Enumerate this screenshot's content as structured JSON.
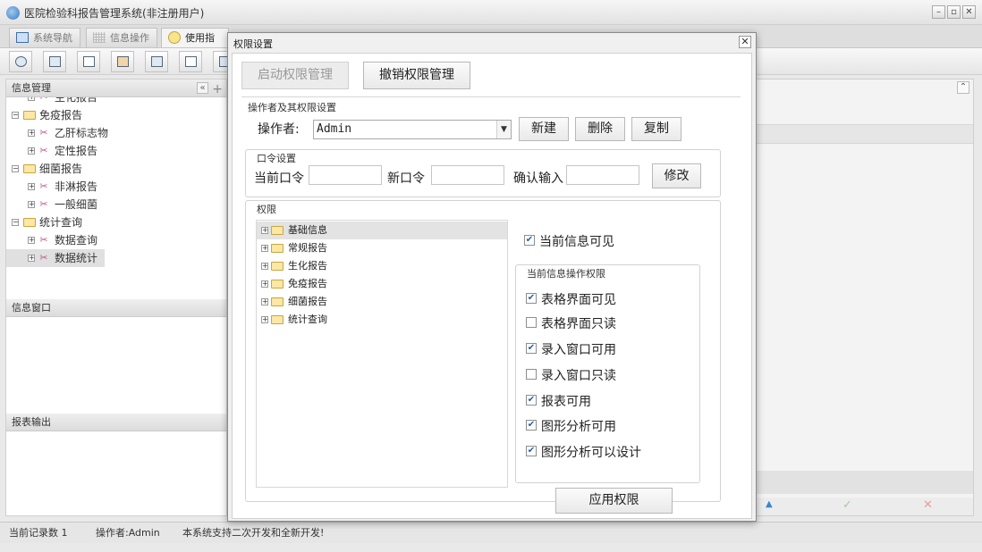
{
  "app": {
    "title": "医院检验科报告管理系统(非注册用户)"
  },
  "tabs": [
    {
      "label": "系统导航"
    },
    {
      "label": "信息操作"
    },
    {
      "label": "使用指南"
    }
  ],
  "left": {
    "info_header": "信息管理",
    "tree": [
      {
        "label": "生化报告",
        "kind": "leaf"
      },
      {
        "label": "免疫报告",
        "kind": "folder"
      },
      {
        "label": "乙肝标志物",
        "kind": "leaf"
      },
      {
        "label": "定性报告",
        "kind": "leaf"
      },
      {
        "label": "细菌报告",
        "kind": "folder"
      },
      {
        "label": "非淋报告",
        "kind": "leaf"
      },
      {
        "label": "一般细菌",
        "kind": "leaf"
      },
      {
        "label": "统计查询",
        "kind": "folder"
      },
      {
        "label": "数据查询",
        "kind": "leaf"
      },
      {
        "label": "数据统计",
        "kind": "leaf",
        "selected": true
      }
    ],
    "window_header": "信息窗口",
    "report_header": "报表输出"
  },
  "status": {
    "records": "当前记录数 1",
    "operator": "操作者:Admin",
    "message": "本系统支持二次开发和全新开发!"
  },
  "dialog": {
    "title": "权限设置",
    "start_btn": "启动权限管理",
    "revoke_btn": "撤销权限管理",
    "section_title": "操作者及其权限设置",
    "operator_label": "操作者:",
    "operator_value": "Admin",
    "new_btn": "新建",
    "delete_btn": "删除",
    "copy_btn": "复制",
    "password": {
      "title": "口令设置",
      "current_label": "当前口令",
      "new_label": "新口令",
      "confirm_label": "确认输入",
      "current_value": "",
      "new_value": "",
      "confirm_value": "",
      "modify_btn": "修改"
    },
    "perm": {
      "title": "权限",
      "tree": [
        "基础信息",
        "常规报告",
        "生化报告",
        "免疫报告",
        "细菌报告",
        "统计查询"
      ],
      "visible_label": "当前信息可见",
      "visible_checked": true,
      "ops_title": "当前信息操作权限",
      "ops": [
        {
          "label": "表格界面可见",
          "checked": true
        },
        {
          "label": "表格界面只读",
          "checked": false
        },
        {
          "label": "录入窗口可用",
          "checked": true
        },
        {
          "label": "录入窗口只读",
          "checked": false
        },
        {
          "label": "报表可用",
          "checked": true
        },
        {
          "label": "图形分析可用",
          "checked": true
        },
        {
          "label": "图形分析可以设计",
          "checked": true
        }
      ],
      "apply_btn": "应用权限"
    }
  }
}
